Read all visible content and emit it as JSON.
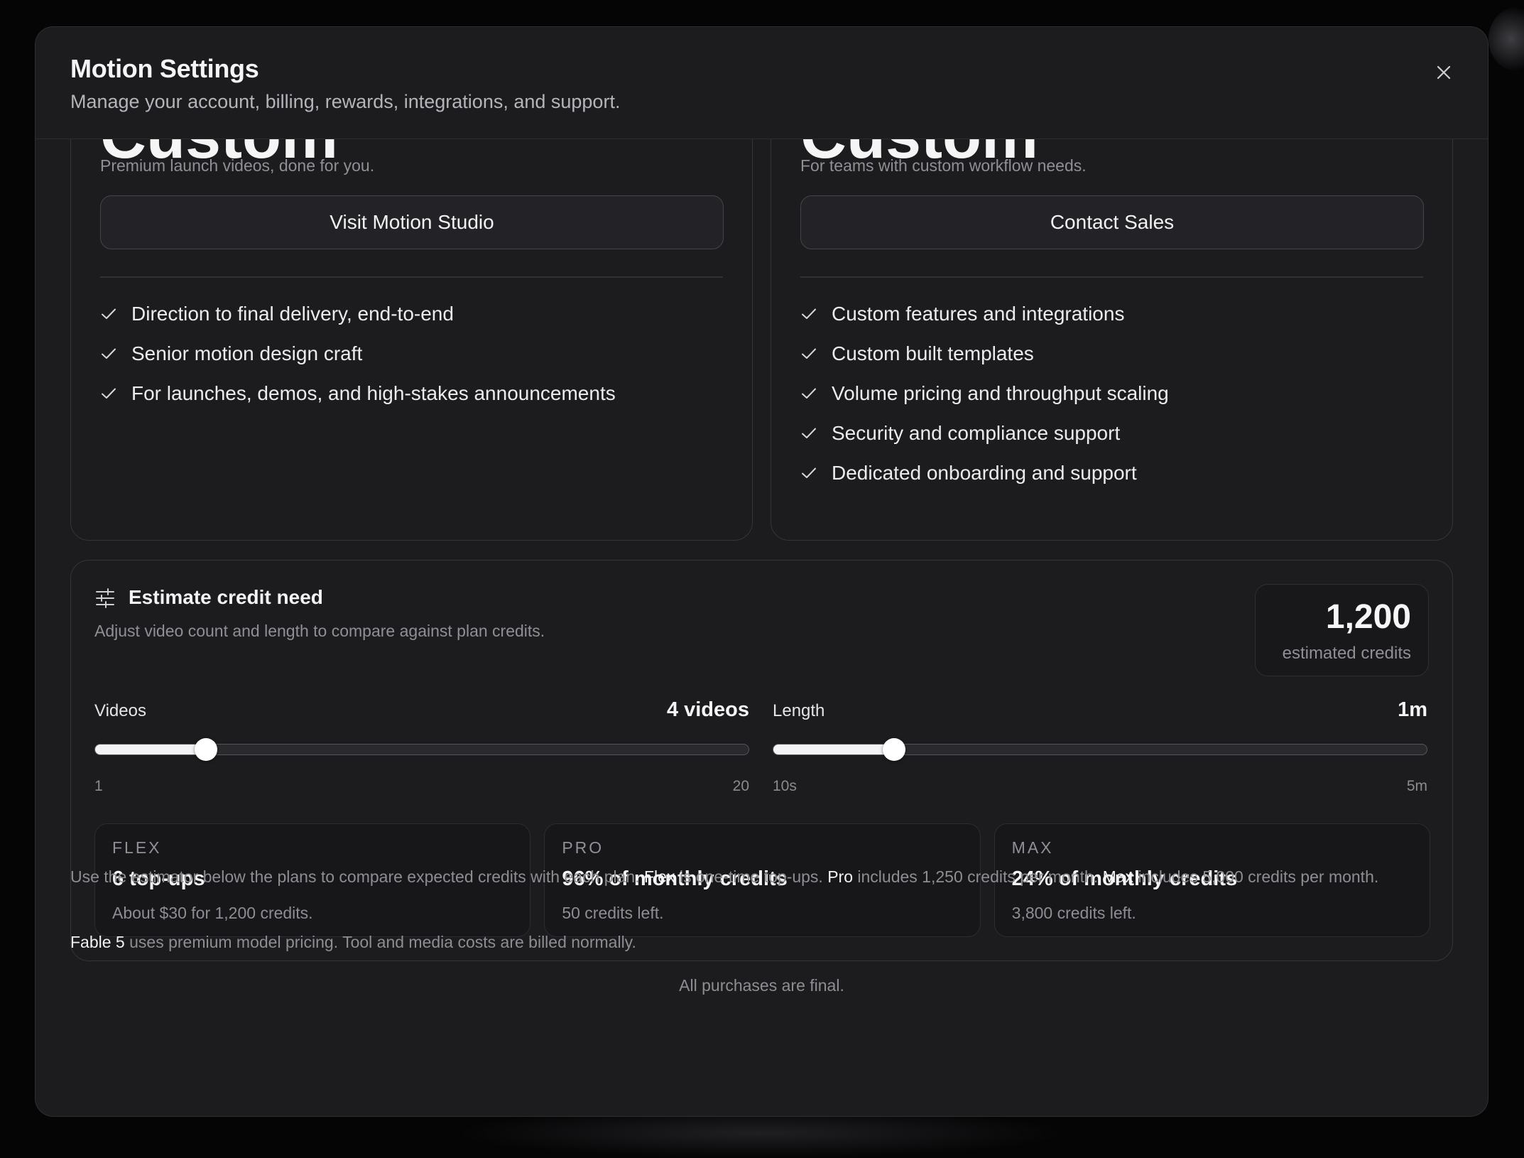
{
  "dialog": {
    "title": "Motion Settings",
    "subtitle": "Manage your account, billing, rewards, integrations, and support."
  },
  "plans": [
    {
      "name": "Custom",
      "tagline": "Premium launch videos, done for you.",
      "cta": "Visit Motion Studio",
      "features": [
        "Direction to final delivery, end-to-end",
        "Senior motion design craft",
        "For launches, demos, and high-stakes announcements"
      ]
    },
    {
      "name": "Custom",
      "tagline": "For teams with custom workflow needs.",
      "cta": "Contact Sales",
      "features": [
        "Custom features and integrations",
        "Custom built templates",
        "Volume pricing and throughput scaling",
        "Security and compliance support",
        "Dedicated onboarding and support"
      ]
    }
  ],
  "estimator": {
    "title": "Estimate credit need",
    "subtitle": "Adjust video count and length to compare against plan credits.",
    "total_value": "1,200",
    "total_label": "estimated credits",
    "videos": {
      "label": "Videos",
      "value_text": "4 videos",
      "min": "1",
      "max": "20",
      "fraction": 0.17
    },
    "length": {
      "label": "Length",
      "value_text": "1m",
      "min": "10s",
      "max": "5m",
      "fraction": 0.185
    },
    "comparisons": [
      {
        "plan": "FLEX",
        "headline": "6 top-ups",
        "detail": "About $30 for 1,200 credits."
      },
      {
        "plan": "PRO",
        "headline": "96% of monthly credits",
        "detail": "50 credits left."
      },
      {
        "plan": "MAX",
        "headline": "24% of monthly credits",
        "detail": "3,800 credits left."
      }
    ]
  },
  "footnotes": {
    "line1": {
      "a": "Use the estimator below the plans to compare expected credits with each plan. ",
      "flex": "Flex",
      "b": " is one-time top-ups. ",
      "pro": "Pro",
      "c": " includes 1,250 credits per month. ",
      "max": "Max",
      "d": " includes 5,000 credits per month."
    },
    "line2": {
      "model": "Fable 5",
      "text": " uses premium model pricing. Tool and media costs are billed normally."
    },
    "final": "All purchases are final."
  },
  "icons": {
    "close": "close-icon",
    "check": "check-icon",
    "sliders": "sliders-icon"
  },
  "colors": {
    "background": "#050506",
    "dialog": "#1c1c1f",
    "accent": "#f4f4f5"
  }
}
